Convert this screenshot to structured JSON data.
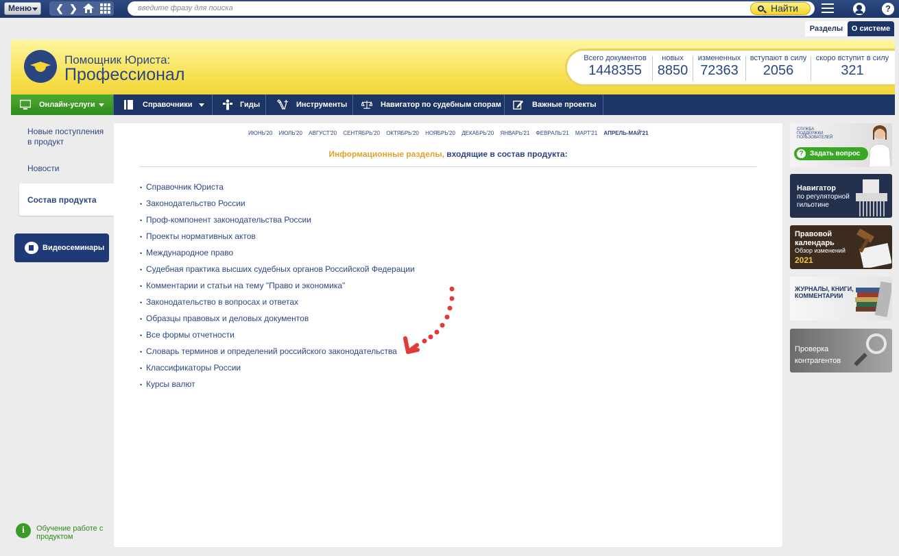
{
  "topbar": {
    "menu_label": "Меню",
    "search_placeholder": "введите фразу для поиска",
    "find_label": "Найти"
  },
  "tabs": [
    {
      "label": "Разделы",
      "active": true
    },
    {
      "label": "О системе",
      "active": false
    }
  ],
  "header": {
    "brand_line1": "Помощник Юриста:",
    "brand_line2": "Профессионал",
    "stats": [
      {
        "label": "Всего документов",
        "value": "1448355"
      },
      {
        "label": "новых",
        "value": "8850"
      },
      {
        "label": "измененных",
        "value": "72363"
      },
      {
        "label": "вступают в силу",
        "value": "2056"
      },
      {
        "label": "скоро вступит в силу",
        "value": "321"
      }
    ]
  },
  "nav": [
    {
      "label": "Онлайн-услуги",
      "icon": "monitor-icon"
    },
    {
      "label": "Справочники",
      "icon": "book-icon"
    },
    {
      "label": "Гиды",
      "icon": "guide-icon"
    },
    {
      "label": "Инструменты",
      "icon": "tools-icon"
    },
    {
      "label": "Навигатор по судебным спорам",
      "icon": "scales-icon"
    },
    {
      "label": "Важные проекты",
      "icon": "edit-icon"
    }
  ],
  "sidebar": {
    "items": [
      {
        "label": "Новые поступления в продукт"
      },
      {
        "label": "Новости"
      },
      {
        "label": "Состав продукта",
        "active": true
      }
    ],
    "video_label": "Видеосеминары",
    "learn_label": "Обучение работе с продуктом"
  },
  "main": {
    "months": [
      "ИЮНЬ'20",
      "ИЮЛЬ'20",
      "АВГУСТ'20",
      "СЕНТЯБРЬ'20",
      "ОКТЯБРЬ'20",
      "НОЯБРЬ'20",
      "ДЕКАБРЬ'20",
      "ЯНВАРЬ'21",
      "ФЕВРАЛЬ'21",
      "МАРТ'21",
      "АПРЕЛЬ-МАЙ'21"
    ],
    "heading_highlight": "Информационные разделы,",
    "heading_rest": " входящие в состав продукта:",
    "sections": [
      "Справочник Юриста",
      "Законодательство России",
      "Проф-компонент законодательства России",
      "Проекты нормативных актов",
      "Международное право",
      "Судебная практика высших судебных органов Российской Федерации",
      "Комментарии и статьи на тему \"Право и экономика\"",
      "Законодательство в вопросах и ответах",
      "Образцы правовых и деловых документов",
      "Все формы отчетности",
      "Словарь терминов и определений российского законодательства",
      "Классификаторы России",
      "Курсы валют"
    ]
  },
  "promos": {
    "support_small": "СЛУЖБА ПОДДЕРЖКИ ПОЛЬЗОВАТЕЛЕЙ",
    "support_button": "Задать вопрос",
    "navigator_title": "Навигатор",
    "navigator_sub": "по регуляторной гильотине",
    "calendar_title": "Правовой календарь",
    "calendar_sub": "Обзор изменений",
    "calendar_year": "2021",
    "journals": "ЖУРНАЛЫ, КНИГИ, КОММЕНТАРИИ",
    "check": "Проверка контрагентов"
  },
  "colors": {
    "brand_blue": "#1d3566",
    "accent_yellow": "#f7df4e",
    "highlight_orange": "#e2a12a",
    "online_green": "#3aa626",
    "annotation_red": "#e23a3a"
  }
}
